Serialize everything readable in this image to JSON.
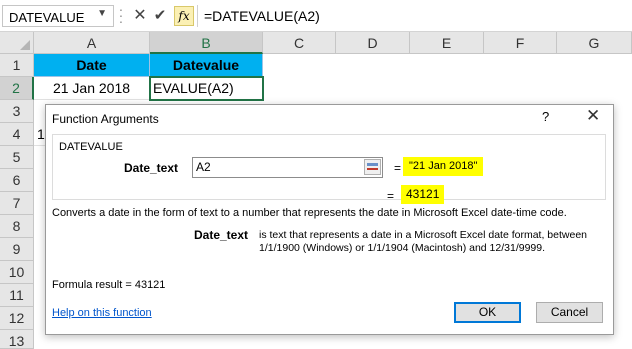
{
  "formula_bar": {
    "name_box": "DATEVALUE",
    "fx": "fx",
    "formula": "=DATEVALUE(A2)"
  },
  "grid": {
    "columns": [
      "A",
      "B",
      "C",
      "D",
      "E",
      "F",
      "G"
    ],
    "rows": [
      "1",
      "2",
      "3",
      "4",
      "5",
      "6",
      "7",
      "8",
      "9",
      "10",
      "11",
      "12",
      "13"
    ],
    "cells": {
      "A1": "Date",
      "B1": "Datevalue",
      "A2": "21 Jan 2018",
      "B2": "EVALUE(A2)",
      "A4": "1"
    },
    "header_color": "#00b0f0"
  },
  "dialog": {
    "title": "Function Arguments",
    "help": "?",
    "close": "✕",
    "function_name": "DATEVALUE",
    "arg_label": "Date_text",
    "arg_value": "A2",
    "arg_eq": "=",
    "arg_result": "\"21 Jan 2018\"",
    "result_eq": "=",
    "result_value": "43121",
    "description": "Converts a date in the form of text to a number that represents the date in Microsoft Excel date-time code.",
    "arg_desc_label": "Date_text",
    "arg_desc": "is text that represents a date in a Microsoft Excel date format, between 1/1/1900 (Windows) or 1/1/1904 (Macintosh) and 12/31/9999.",
    "formula_result": "Formula result =    43121",
    "help_link": "Help on this function",
    "ok": "OK",
    "cancel": "Cancel",
    "highlight_color": "#ffff00"
  }
}
